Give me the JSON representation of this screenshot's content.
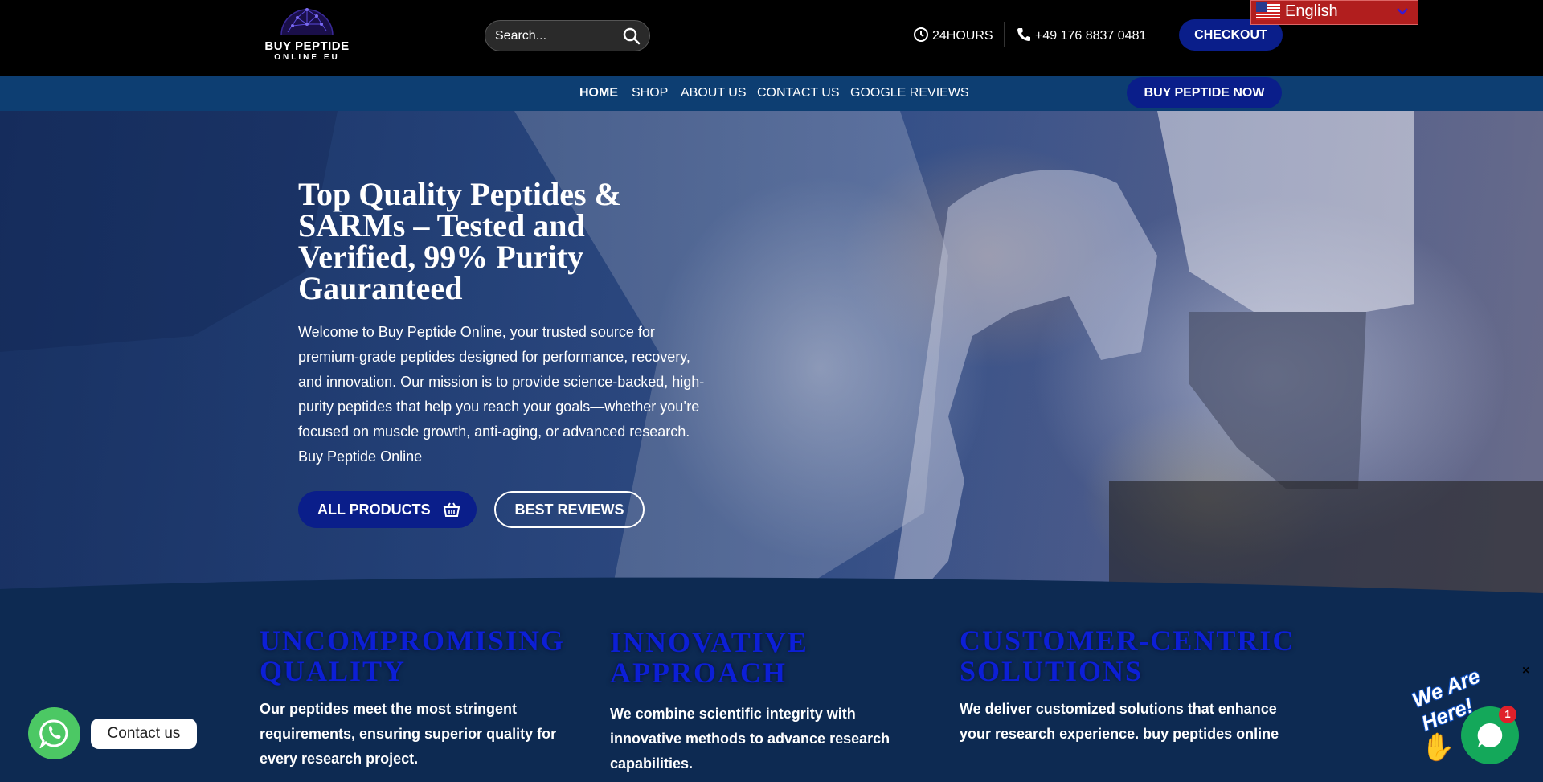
{
  "header": {
    "logo_line1": "BUY PEPTIDE",
    "logo_line2": "ONLINE EU",
    "search_placeholder": "Search...",
    "hours": "24HOURS",
    "phone": "+49 176 8837 0481",
    "checkout_label": "CHECKOUT",
    "language": "English"
  },
  "nav": {
    "items": [
      {
        "label": "HOME",
        "active": true
      },
      {
        "label": "SHOP"
      },
      {
        "label": "ABOUT US"
      },
      {
        "label": "CONTACT US"
      },
      {
        "label": "GOOGLE REVIEWS"
      }
    ],
    "cta_label": "BUY PEPTIDE NOW"
  },
  "hero": {
    "title": "Top Quality Peptides & SARMs – Tested and Verified, 99% Purity Gauranteed",
    "text": "Welcome to Buy Peptide Online, your trusted source for premium-grade peptides designed for performance, recovery, and innovation. Our mission is to provide science-backed, high-purity peptides that help you reach your goals—whether you’re focused on muscle growth, anti-aging, or advanced research. Buy Peptide Online",
    "primary_button": "ALL PRODUCTS",
    "secondary_button": "BEST REVIEWS"
  },
  "features": [
    {
      "title": "UNCOMPROMISING QUALITY",
      "text": "Our peptides meet the most stringent requirements, ensuring superior quality for every research project."
    },
    {
      "title": "INNOVATIVE APPROACH",
      "text": "We combine scientific integrity with innovative methods to advance research capabilities."
    },
    {
      "title": "CUSTOMER-CENTRIC SOLUTIONS",
      "text": "We deliver customized solutions that enhance your research experience. buy peptides online"
    }
  ],
  "widgets": {
    "whatsapp_label": "Contact us",
    "chat_tagline": "We Are Here!",
    "chat_badge": "1",
    "chat_close": "×"
  },
  "colors": {
    "brand_blue": "#0a1e8a",
    "nav_bg": "#0d3e72",
    "feature_title": "#0c1fd6",
    "whatsapp_green": "#4cc864",
    "chat_green": "#14a85a"
  },
  "icons": [
    "logo-network-icon",
    "search-icon",
    "clock-icon",
    "phone-icon",
    "us-flag-icon",
    "chevron-down-icon",
    "basket-icon",
    "whatsapp-icon",
    "chat-icon",
    "waving-hand-icon"
  ]
}
